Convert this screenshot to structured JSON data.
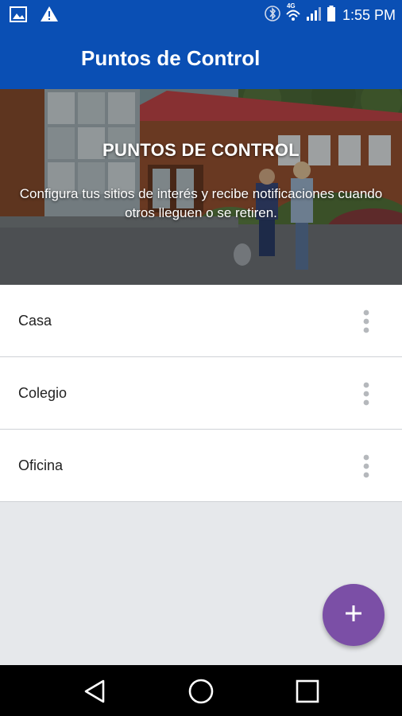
{
  "status_bar": {
    "time": "1:55 PM",
    "network_label": "4G",
    "icons": [
      "image-icon",
      "warning-icon",
      "bluetooth-icon",
      "wifi-icon",
      "signal-icon",
      "battery-icon"
    ]
  },
  "app_bar": {
    "title": "Puntos de Control"
  },
  "hero": {
    "title": "PUNTOS DE CONTROL",
    "subtitle": "Configura tus sitios de interés y recibe notificaciones cuando otros lleguen o se retiren."
  },
  "places": [
    {
      "label": "Casa"
    },
    {
      "label": "Colegio"
    },
    {
      "label": "Oficina"
    }
  ],
  "fab": {
    "icon": "plus-icon"
  },
  "nav_bar": {
    "icons": [
      "back-icon",
      "home-icon",
      "recents-icon"
    ]
  },
  "colors": {
    "primary": "#0a4fb4",
    "fab": "#7b4fa6",
    "background": "#e6e8eb"
  }
}
